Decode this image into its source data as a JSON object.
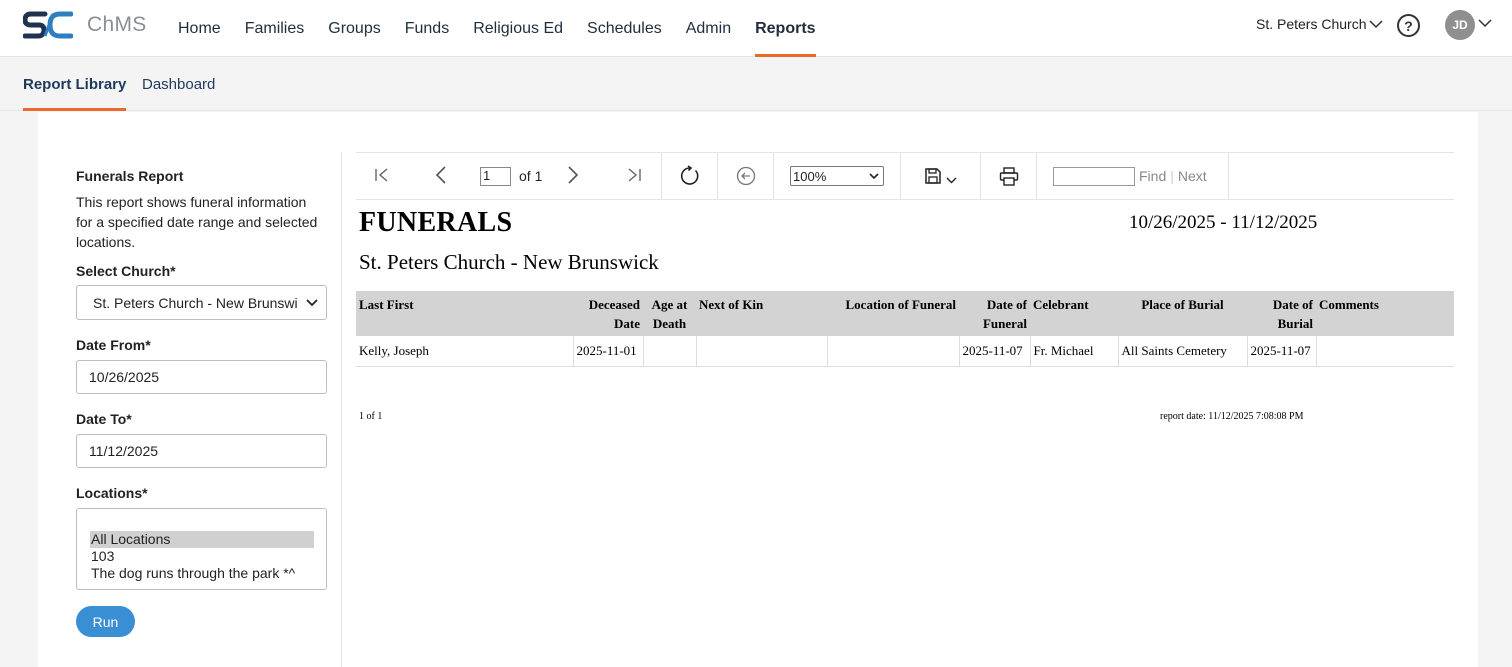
{
  "brand": {
    "logo_text": "SC",
    "app_name": "ChMS",
    "logo_color_dark": "#1f3350",
    "logo_color_accent": "#2e7fc1"
  },
  "nav": {
    "items": [
      "Home",
      "Families",
      "Groups",
      "Funds",
      "Religious Ed",
      "Schedules",
      "Admin",
      "Reports"
    ],
    "active": "Reports",
    "accent": "#e8682d"
  },
  "header": {
    "church": "St. Peters Church",
    "help_icon": "question-circle-icon",
    "user_initials": "JD"
  },
  "subnav": {
    "items": [
      "Report Library",
      "Dashboard"
    ],
    "active": "Report Library"
  },
  "form": {
    "title": "Funerals Report",
    "description": "This report shows funeral information for a specified date range and selected locations.",
    "church_label": "Select Church*",
    "church_value": "St. Peters Church - New Brunswick",
    "date_from_label": "Date From*",
    "date_from": "10/26/2025",
    "date_to_label": "Date To*",
    "date_to": "11/12/2025",
    "locations_label": "Locations*",
    "locations": [
      "All Locations",
      "103",
      "The dog runs through the park *^"
    ],
    "locations_selected": "All Locations",
    "run_label": "Run",
    "run_color": "#3a8fd4"
  },
  "toolbar": {
    "page": "1",
    "of_pages": "of 1",
    "zoom": "100%",
    "find_label": "Find",
    "next_label": "Next",
    "icons": [
      "first-page-icon",
      "prev-page-icon",
      "next-page-icon",
      "last-page-icon",
      "refresh-icon",
      "back-icon",
      "save-icon",
      "print-icon"
    ]
  },
  "report": {
    "title": "FUNERALS",
    "date_range": "10/26/2025 - 11/12/2025",
    "subtitle": "St. Peters Church - New Brunswick",
    "columns": [
      {
        "l1": "Last First",
        "l2": ""
      },
      {
        "l1": "Deceased",
        "l2": "Date"
      },
      {
        "l1": "Age at",
        "l2": "Death"
      },
      {
        "l1": "Next of Kin",
        "l2": ""
      },
      {
        "l1": "Location of Funeral",
        "l2": ""
      },
      {
        "l1": "Date of",
        "l2": "Funeral"
      },
      {
        "l1": "Celebrant",
        "l2": ""
      },
      {
        "l1": "Place of Burial",
        "l2": ""
      },
      {
        "l1": "Date of",
        "l2": "Burial"
      },
      {
        "l1": "Comments",
        "l2": ""
      }
    ],
    "rows": [
      [
        "Kelly, Joseph",
        "2025-11-01",
        "",
        "",
        "",
        "2025-11-07",
        "Fr. Michael",
        "All Saints Cemetery",
        "2025-11-07",
        ""
      ]
    ],
    "page_footer": "1 of 1",
    "report_date": "report date: 11/12/2025 7:08:08 PM"
  }
}
